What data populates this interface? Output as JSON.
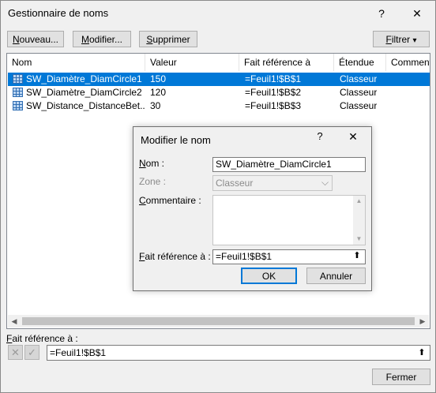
{
  "window": {
    "title": "Gestionnaire de noms",
    "help": "?",
    "close": "✕"
  },
  "toolbar": {
    "new_first": "N",
    "new_rest": "ouveau...",
    "edit_first": "M",
    "edit_rest": "odifier...",
    "delete_first": "S",
    "delete_rest": "upprimer",
    "filter_first": "F",
    "filter_rest": "iltrer",
    "filter_arrow": "▾"
  },
  "list": {
    "columns": [
      "Nom",
      "Valeur",
      "Fait référence à",
      "Étendue",
      "Comment"
    ],
    "rows": [
      {
        "name": "SW_Diamètre_DiamCircle1",
        "value": "150",
        "ref": "=Feuil1!$B$1",
        "scope": "Classeur"
      },
      {
        "name": "SW_Diamètre_DiamCircle2",
        "value": "120",
        "ref": "=Feuil1!$B$2",
        "scope": "Classeur"
      },
      {
        "name": "SW_Distance_DistanceBet...",
        "value": "30",
        "ref": "=Feuil1!$B$3",
        "scope": "Classeur"
      }
    ],
    "scroll_left": "◀",
    "scroll_right": "▶"
  },
  "bottom": {
    "ref_label_first": "F",
    "ref_label_rest": "ait référence à :",
    "ref_value": "=Feuil1!$B$1",
    "cancel_icon": "✕",
    "ok_icon": "✓",
    "collapse_icon": "⬆",
    "close_label": "Fermer"
  },
  "dialog": {
    "title": "Modifier le nom",
    "help": "?",
    "close": "✕",
    "name_label_first": "N",
    "name_label_rest": "om :",
    "name_value": "SW_Diamètre_DiamCircle1",
    "scope_label": "Zone :",
    "scope_value": "Classeur",
    "scope_arrow": "⌵",
    "comment_label_first": "C",
    "comment_label_rest": "ommentaire :",
    "comment_up": "▲",
    "comment_down": "▼",
    "ref_label_first": "F",
    "ref_label_rest": "ait référence à :",
    "ref_value": "=Feuil1!$B$1",
    "collapse_icon": "⬆",
    "ok_label": "OK",
    "cancel_label": "Annuler"
  }
}
